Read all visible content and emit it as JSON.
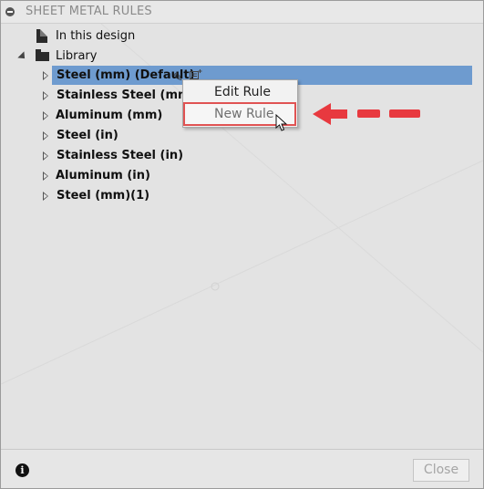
{
  "header": {
    "title": "SHEET METAL RULES",
    "collapse_icon": "minus-circle-icon"
  },
  "tree": {
    "in_this_design": {
      "label": "In this design",
      "icon": "document-icon"
    },
    "library": {
      "label": "Library",
      "icon": "folder-icon",
      "expanded": true,
      "items": [
        {
          "label": "Steel (mm) (Default)",
          "selected": true
        },
        {
          "label": "Stainless Steel (mm)"
        },
        {
          "label": "Aluminum (mm)"
        },
        {
          "label": "Steel (in)"
        },
        {
          "label": "Stainless Steel (in)"
        },
        {
          "label": "Aluminum (in)"
        },
        {
          "label": "Steel (mm)(1)"
        }
      ]
    }
  },
  "row_actions": {
    "edit_icon": "pencil-icon",
    "new_icon": "new-rule-icon"
  },
  "context_menu": {
    "items": [
      {
        "label": "Edit Rule"
      },
      {
        "label": "New Rule",
        "hovered": true
      }
    ]
  },
  "annotation": {
    "color": "#e8393f",
    "shape": "dashed-arrow-left",
    "highlight": "new-rule-outline"
  },
  "footer": {
    "info_icon": "info-icon",
    "close_label": "Close",
    "close_enabled": false
  },
  "colors": {
    "selection": "#6e9bcf",
    "panel": "#e3e3e3",
    "annotation_red": "#e8393f"
  }
}
